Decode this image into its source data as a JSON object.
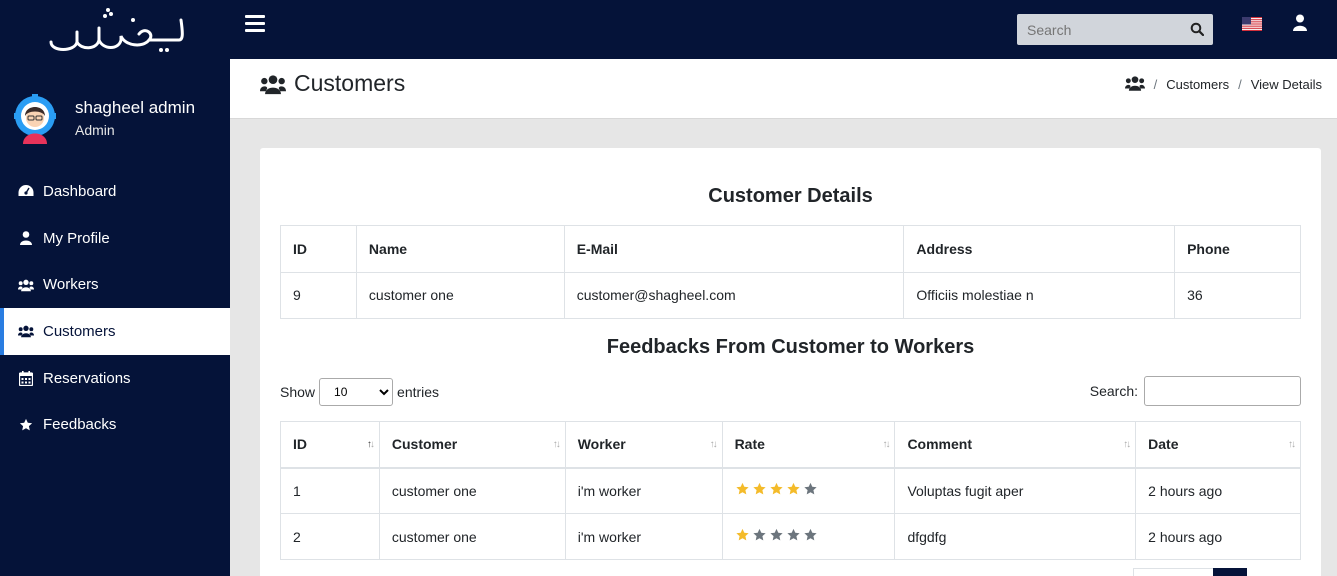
{
  "app": {
    "logo_text": "شغيل"
  },
  "user": {
    "name": "shagheel admin",
    "role": "Admin"
  },
  "sidebar": {
    "items": [
      {
        "label": "Dashboard",
        "icon": "dashboard-icon"
      },
      {
        "label": "My Profile",
        "icon": "user-icon"
      },
      {
        "label": "Workers",
        "icon": "users-icon"
      },
      {
        "label": "Customers",
        "icon": "users-icon",
        "active": true
      },
      {
        "label": "Reservations",
        "icon": "calendar-icon"
      },
      {
        "label": "Feedbacks",
        "icon": "star-icon"
      }
    ]
  },
  "topbar": {
    "search_placeholder": "Search"
  },
  "header": {
    "title": "Customers",
    "breadcrumb": [
      "Customers",
      "View Details"
    ]
  },
  "customer_details": {
    "title": "Customer Details",
    "columns": [
      "ID",
      "Name",
      "E-Mail",
      "Address",
      "Phone"
    ],
    "row": [
      "9",
      "customer one",
      "customer@shagheel.com",
      "Officiis molestiae n",
      "36"
    ]
  },
  "feedbacks": {
    "title": "Feedbacks From Customer to Workers",
    "show_label": "Show",
    "entries_label": "entries",
    "page_length": "10",
    "search_label": "Search:",
    "columns": [
      "ID",
      "Customer",
      "Worker",
      "Rate",
      "Comment",
      "Date"
    ],
    "rows": [
      {
        "id": "1",
        "customer": "customer one",
        "worker": "i'm worker",
        "rate": 4,
        "comment": "Voluptas fugit aper",
        "date": "2 hours ago"
      },
      {
        "id": "2",
        "customer": "customer one",
        "worker": "i'm worker",
        "rate": 1,
        "comment": "dfgdfg",
        "date": "2 hours ago"
      }
    ]
  },
  "colors": {
    "sidebar_bg": "#051339",
    "star_on": "#f4bb2a",
    "star_off": "#6c757d",
    "active_border": "#2a7de1"
  }
}
